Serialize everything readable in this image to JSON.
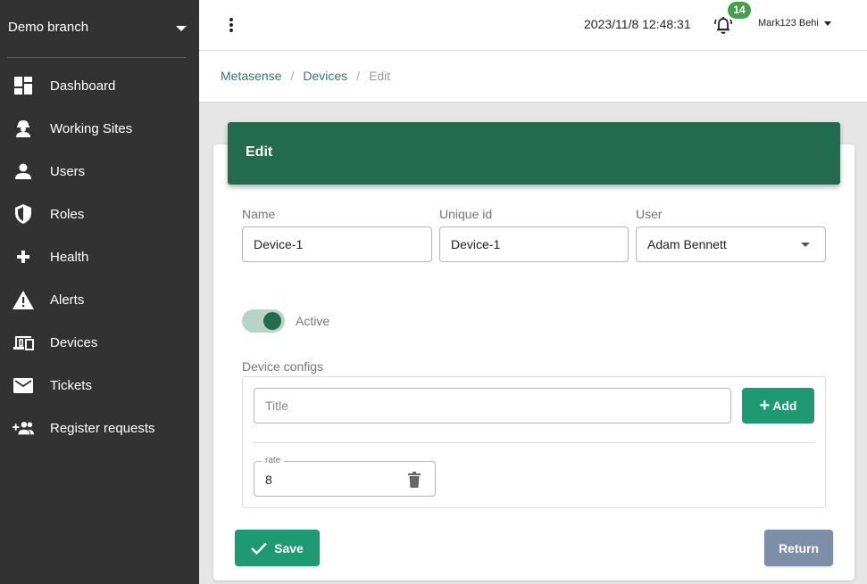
{
  "sidebar": {
    "branch": "Demo branch",
    "items": [
      {
        "label": "Dashboard",
        "icon": "dashboard-icon"
      },
      {
        "label": "Working Sites",
        "icon": "worker-icon"
      },
      {
        "label": "Users",
        "icon": "user-icon"
      },
      {
        "label": "Roles",
        "icon": "shield-icon"
      },
      {
        "label": "Health",
        "icon": "plus-icon"
      },
      {
        "label": "Alerts",
        "icon": "warning-icon"
      },
      {
        "label": "Devices",
        "icon": "devices-icon"
      },
      {
        "label": "Tickets",
        "icon": "mail-icon"
      },
      {
        "label": "Register requests",
        "icon": "add-group-icon"
      }
    ]
  },
  "topbar": {
    "datetime": "2023/11/8 12:48:31",
    "notification_count": "14",
    "username": "Mark123 Behi"
  },
  "breadcrumb": {
    "items": [
      "Metasense",
      "Devices"
    ],
    "current": "Edit"
  },
  "form": {
    "title": "Edit",
    "name": {
      "label": "Name",
      "value": "Device-1"
    },
    "unique_id": {
      "label": "Unique id",
      "value": "Device-1"
    },
    "user": {
      "label": "User",
      "value": "Adam Bennett"
    },
    "active": {
      "label": "Active",
      "on": true
    },
    "configs": {
      "label": "Device configs",
      "title_placeholder": "Title",
      "add_label": "Add",
      "entries": [
        {
          "key": "rate",
          "value": "8"
        }
      ]
    },
    "save_label": "Save",
    "return_label": "Return"
  },
  "colors": {
    "sidebar_bg": "#323232",
    "header_green": "#236b50",
    "button_green": "#1e9a72",
    "badge_green": "#43a047",
    "return_gray": "#7d8fa6",
    "link_green": "#2e7d5e"
  }
}
